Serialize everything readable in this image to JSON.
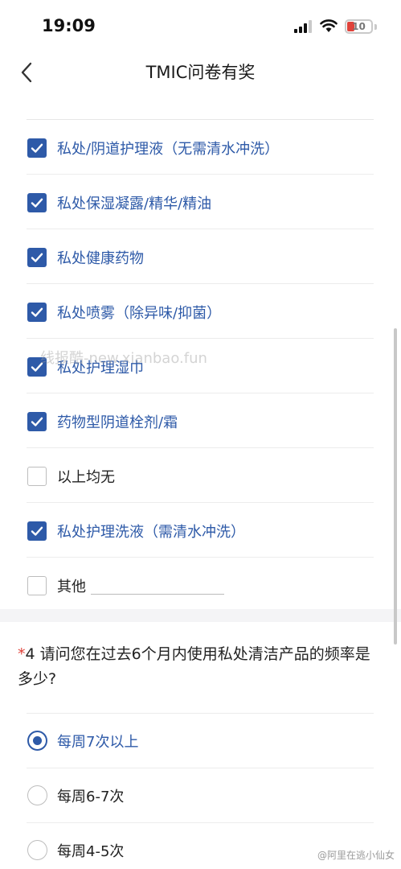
{
  "status_bar": {
    "time": "19:09",
    "battery_level": "10"
  },
  "nav": {
    "title": "TMIC问卷有奖"
  },
  "options": [
    {
      "label": "私处/阴道护理液（无需清水冲洗）",
      "checked": true
    },
    {
      "label": "私处保湿凝露/精华/精油",
      "checked": true
    },
    {
      "label": "私处健康药物",
      "checked": true
    },
    {
      "label": "私处喷雾（除异味/抑菌）",
      "checked": true
    },
    {
      "label": "私处护理湿巾",
      "checked": true
    },
    {
      "label": "药物型阴道栓剂/霜",
      "checked": true
    },
    {
      "label": "以上均无",
      "checked": false
    },
    {
      "label": "私处护理洗液（需清水冲洗）",
      "checked": true
    },
    {
      "label": "其他",
      "checked": false
    }
  ],
  "question": {
    "required_mark": "*",
    "text": "4 请问您在过去6个月内使用私处清洁产品的频率是多少?"
  },
  "radio_options": [
    {
      "label": "每周7次以上",
      "selected": true
    },
    {
      "label": "每周6-7次",
      "selected": false
    },
    {
      "label": "每周4-5次",
      "selected": false
    }
  ],
  "watermarks": {
    "center": "线报酷-new.xianbao.fun",
    "corner": "@阿里在逃小仙女"
  },
  "colors": {
    "accent": "#2e5aa8",
    "required": "#e0423a"
  }
}
